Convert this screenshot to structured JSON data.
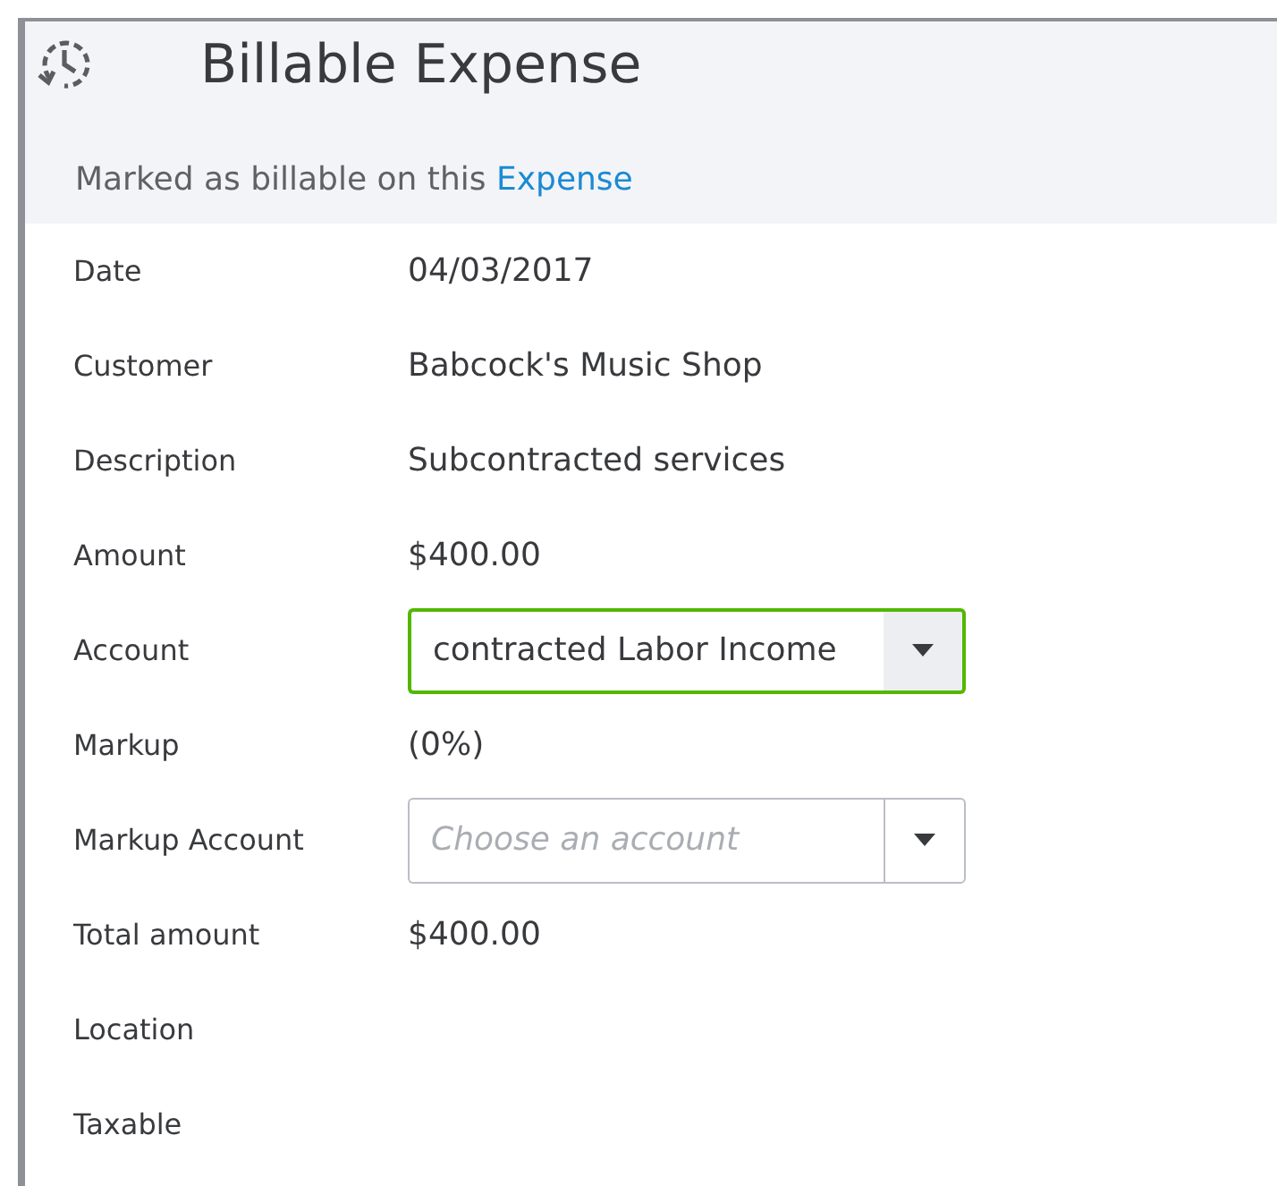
{
  "header": {
    "title": "Billable Expense",
    "note": "Marked as billable on this ",
    "link": "Expense"
  },
  "rows": [
    {
      "kind": "text",
      "label": "Date",
      "value": "04/03/2017"
    },
    {
      "kind": "text",
      "label": "Customer",
      "value": "Babcock's Music Shop"
    },
    {
      "kind": "text",
      "label": "Description",
      "value": "Subcontracted services"
    },
    {
      "kind": "text",
      "label": "Amount",
      "value": "$400.00"
    },
    {
      "kind": "select",
      "label": "Account",
      "value": "contracted Labor Income",
      "focused": true
    },
    {
      "kind": "text",
      "label": "Markup",
      "value": "(0%)"
    },
    {
      "kind": "select",
      "label": "Markup Account",
      "placeholder": "Choose an account",
      "focused": false
    },
    {
      "kind": "text",
      "label": "Total amount",
      "value": "$400.00"
    },
    {
      "kind": "text",
      "label": "Location"
    },
    {
      "kind": "text",
      "label": "Taxable"
    }
  ]
}
